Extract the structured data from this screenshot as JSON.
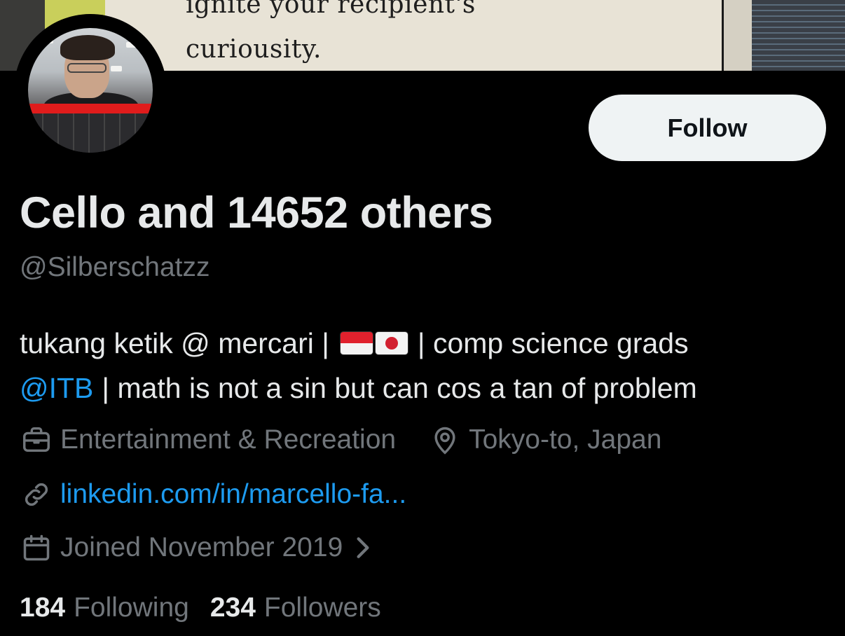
{
  "banner": {
    "line1": "ignite your recipient's",
    "line2": "curiousity."
  },
  "profile": {
    "display_name": "Cello and 14652 others",
    "handle": "@Silberschatzz",
    "follow_label": "Follow"
  },
  "bio": {
    "line1_prefix": "tukang ketik @ mercari |",
    "line1_suffix": "| comp science grads",
    "mention": "@ITB",
    "line2_rest": "| math is not a sin but can cos a tan of problem",
    "flags": [
      "flag-indonesia",
      "flag-japan"
    ]
  },
  "meta": {
    "category": "Entertainment & Recreation",
    "location": "Tokyo-to, Japan",
    "website": "linkedin.com/in/marcello-fa...",
    "joined": "Joined November 2019"
  },
  "stats": {
    "following_count": "184",
    "following_label": "Following",
    "followers_count": "234",
    "followers_label": "Followers"
  },
  "icons": {
    "category": "briefcase-icon",
    "location": "location-pin-icon",
    "website": "link-icon",
    "joined": "calendar-icon",
    "joined_more": "chevron-right-icon"
  },
  "colors": {
    "background": "#000000",
    "primary_text": "#e7e9ea",
    "secondary_text": "#71767b",
    "link": "#1d9bf0",
    "follow_bg": "#eff3f4"
  }
}
